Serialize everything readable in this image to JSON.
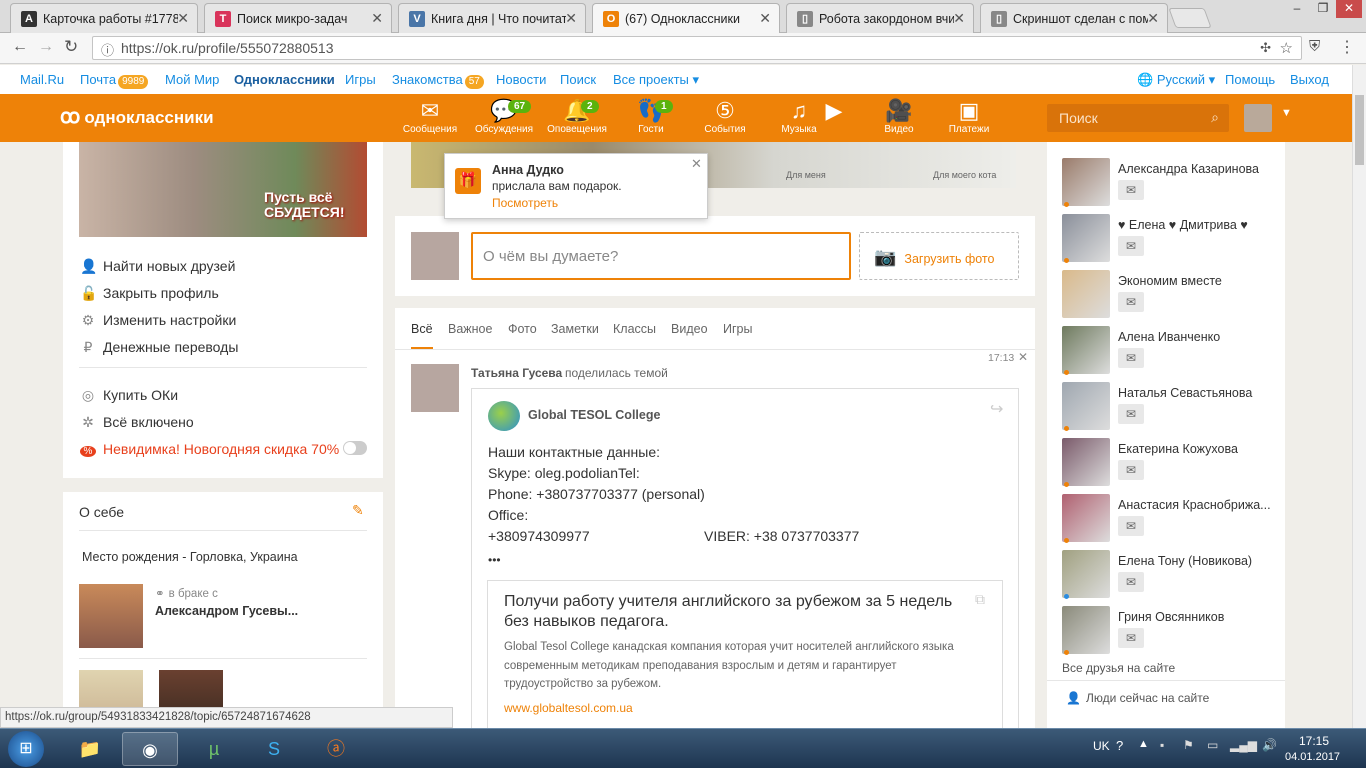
{
  "browser": {
    "tabs": [
      {
        "favicon_letter": "A",
        "favicon_color": "#333333",
        "title": "Карточка работы #1778"
      },
      {
        "favicon_letter": "Tr",
        "favicon_color": "#d9345b",
        "title": "Поиск микро-задач"
      },
      {
        "favicon_letter": "vk",
        "favicon_color": "#4a76a8",
        "title": "Книга дня | Что почитать"
      },
      {
        "favicon_letter": "ok",
        "favicon_color": "#ee8208",
        "title": "(67) Одноклассники"
      },
      {
        "favicon_letter": "▯",
        "favicon_color": "#888888",
        "title": "Робота закордоном вчит"
      },
      {
        "favicon_letter": "▯",
        "favicon_color": "#888888",
        "title": "Скриншот сделан с пом"
      }
    ],
    "url": "https://ok.ru/profile/555072880513",
    "status_url": "https://ok.ru/group/54931833421828/topic/65724871674628"
  },
  "mailbar": {
    "items": [
      {
        "label": "Mail.Ru"
      },
      {
        "label": "Почта",
        "badge": "9989"
      },
      {
        "label": "Мой Мир"
      },
      {
        "label": "Одноклассники"
      },
      {
        "label": "Игры"
      },
      {
        "label": "Знакомства",
        "badge": "57"
      },
      {
        "label": "Новости"
      },
      {
        "label": "Поиск"
      },
      {
        "label": "Все проекты ▾"
      }
    ],
    "language": "Русский ▾",
    "help": "Помощь",
    "logout": "Выход"
  },
  "okbar": {
    "logo": "одноклассники",
    "nav": [
      {
        "label": "Сообщения",
        "icon": "envelope-icon",
        "glyph": "✉"
      },
      {
        "label": "Обсуждения",
        "icon": "chat-icon",
        "glyph": "💬",
        "badge": "67"
      },
      {
        "label": "Оповещения",
        "icon": "bell-icon",
        "glyph": "🔔",
        "badge": "2"
      },
      {
        "label": "Гости",
        "icon": "footprints-icon",
        "glyph": "👣",
        "badge": "1"
      },
      {
        "label": "События",
        "icon": "events-icon",
        "glyph": "⑤"
      },
      {
        "label": "Музыка",
        "icon": "music-icon",
        "glyph": "♫"
      },
      {
        "label": "",
        "icon": "play-icon",
        "glyph": "▶"
      },
      {
        "label": "Видео",
        "icon": "video-camera-icon",
        "glyph": "🎥"
      },
      {
        "label": "Платежи",
        "icon": "wallet-icon",
        "glyph": "▣"
      }
    ],
    "search_placeholder": "Поиск"
  },
  "left": {
    "banner_text": "Пусть всё СБУДЕТСЯ!",
    "menu1": [
      {
        "label": "Найти новых друзей",
        "icon": "person-icon",
        "glyph": "👤"
      },
      {
        "label": "Закрыть профиль",
        "icon": "lock-icon",
        "glyph": "🔓"
      },
      {
        "label": "Изменить настройки",
        "icon": "gear-icon",
        "glyph": "⚙"
      },
      {
        "label": "Денежные переводы",
        "icon": "ruble-icon",
        "glyph": "₽"
      }
    ],
    "menu2": [
      {
        "label": "Купить ОКи",
        "icon": "coins-icon",
        "glyph": "◎"
      },
      {
        "label": "Всё включено",
        "icon": "sparkle-icon",
        "glyph": "✲"
      },
      {
        "label": "Невидимка! Новогодняя скидка 70%",
        "icon": "percent-icon",
        "glyph": "%"
      }
    ],
    "about_title": "О себе",
    "birthplace": "Место рождения - Горловка, Украина",
    "married_label": "в браке с",
    "spouse": "Александром Гусевы..."
  },
  "notification": {
    "name": "Анна Дудко",
    "text": "прислала вам подарок.",
    "link": "Посмотреть"
  },
  "post_box": {
    "placeholder": "О чём вы думаете?",
    "upload": "Загрузить фото"
  },
  "photo_captions": [
    "Для меня",
    "Для моего кота"
  ],
  "feed_tabs": [
    "Всё",
    "Важное",
    "Фото",
    "Заметки",
    "Классы",
    "Видео",
    "Игры"
  ],
  "post": {
    "time": "17:13",
    "author": "Татьяна Гусева",
    "action": "поделилась темой",
    "group": "Global TESOL College",
    "lines": [
      "Наши контактные данные:",
      "Skype: oleg.podolianTel:",
      "Phone: +380737703377 (personal)",
      "Office:"
    ],
    "phone": "+380974309977",
    "viber": "VIBER: +38 0737703377",
    "more": "•••",
    "link_title": "Получи работу учителя английского за рубежом за 5 недель без навыков педагога.",
    "link_desc": "Global Tesol College канадская компания которая учит носителей английского языка современным методикам преподавания взрослым и детям и гарантирует трудоустройство за рубежом.",
    "link_url": "www.globaltesol.com.ua"
  },
  "friends": [
    {
      "name": "Александра Казаринова",
      "color": "#9a7b6a",
      "online": "#ee8208"
    },
    {
      "name": "♥ Елена ♥ Дмитрива ♥",
      "color": "#8a8f9a",
      "online": "#ee8208"
    },
    {
      "name": "Экономим вместе",
      "color": "#d9b98a",
      "online": ""
    },
    {
      "name": "Алена Иванченко",
      "color": "#6e7a5e",
      "online": "#ee8208"
    },
    {
      "name": "Наталья Севастьянова",
      "color": "#9fa7b0",
      "online": "#ee8208"
    },
    {
      "name": "Екатерина Кожухова",
      "color": "#7a5a6a",
      "online": "#ee8208"
    },
    {
      "name": "Анастасия Краснобрижа...",
      "color": "#b06070",
      "online": "#ee8208"
    },
    {
      "name": "Елена Тону (Новикова)",
      "color": "#a0a080",
      "online": "#2b8ce0"
    },
    {
      "name": "Гриня Овсянников",
      "color": "#8a8a7a",
      "online": "#ee8208"
    }
  ],
  "friends_all": "Все друзья на сайте",
  "people_now": "Люди сейчас на сайте",
  "taskbar": {
    "lang": "UK",
    "time": "17:15",
    "date": "04.01.2017"
  }
}
